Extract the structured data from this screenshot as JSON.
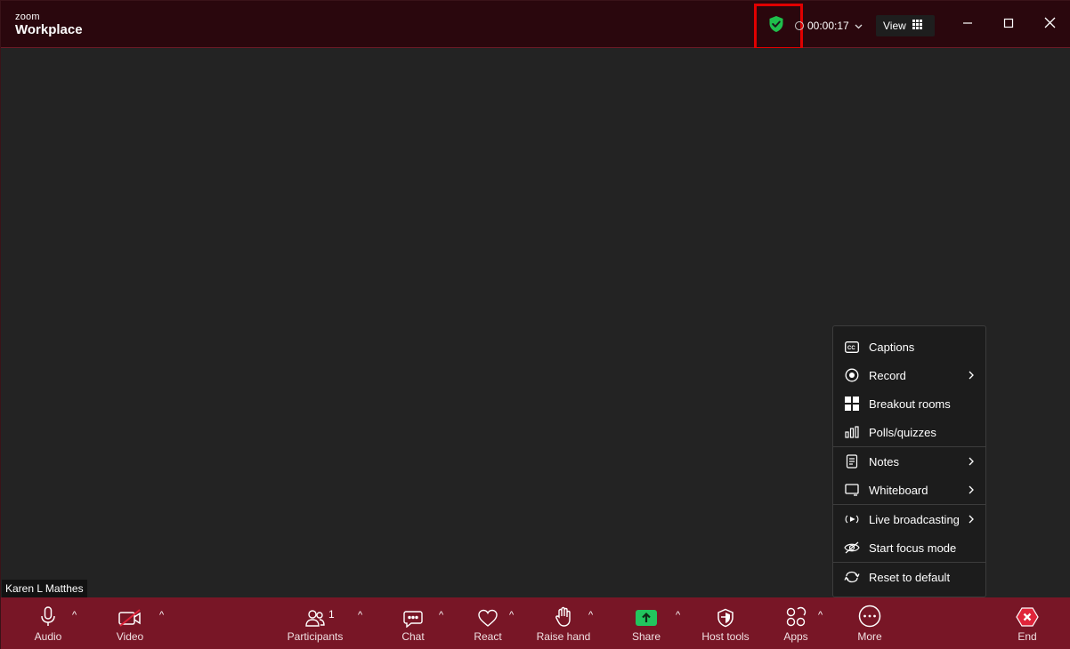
{
  "app": {
    "brand_small": "zoom",
    "brand_large": "Workplace"
  },
  "titlebar": {
    "timer": "00:00:17",
    "view_label": "View"
  },
  "participant": {
    "name": "Karen L Matthes"
  },
  "more_menu": {
    "items": [
      {
        "label": "Captions",
        "icon": "captions-icon",
        "submenu": false
      },
      {
        "label": "Record",
        "icon": "record-icon",
        "submenu": true
      },
      {
        "label": "Breakout rooms",
        "icon": "breakout-rooms-icon",
        "submenu": false
      },
      {
        "label": "Polls/quizzes",
        "icon": "polls-icon",
        "submenu": false
      },
      {
        "label": "Notes",
        "icon": "notes-icon",
        "submenu": true
      },
      {
        "label": "Whiteboard",
        "icon": "whiteboard-icon",
        "submenu": true
      },
      {
        "label": "Live broadcasting",
        "icon": "live-broadcast-icon",
        "submenu": true
      },
      {
        "label": "Start focus mode",
        "icon": "focus-mode-icon",
        "submenu": false
      },
      {
        "label": "Reset to default",
        "icon": "reset-icon",
        "submenu": false
      }
    ]
  },
  "toolbar": {
    "audio": "Audio",
    "video": "Video",
    "participants": "Participants",
    "participants_count": "1",
    "chat": "Chat",
    "react": "React",
    "raise_hand": "Raise hand",
    "share": "Share",
    "host_tools": "Host tools",
    "apps": "Apps",
    "more": "More",
    "end": "End"
  },
  "colors": {
    "toolbar_bg": "#781626",
    "titlebar_bg": "#2a070d",
    "share_green": "#22c55e",
    "shield_green": "#1fbf4c",
    "end_red": "#e0243a",
    "highlight_red": "#e00000"
  }
}
